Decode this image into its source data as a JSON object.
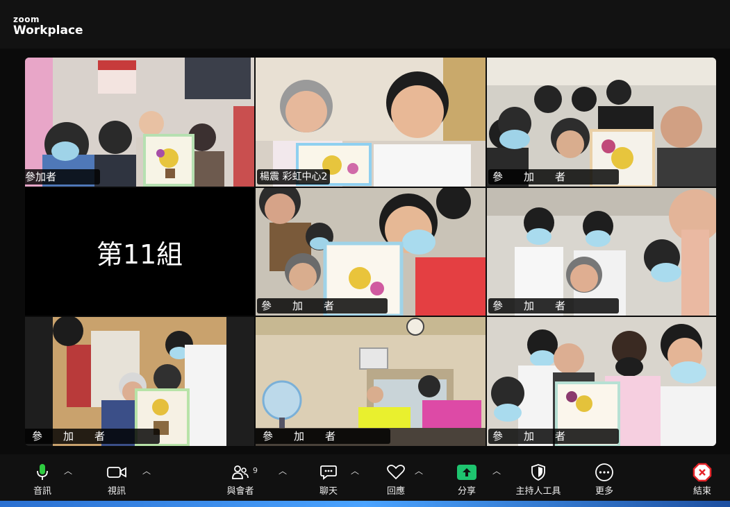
{
  "app": {
    "logo_top": "zoom",
    "logo_bottom": "Workplace"
  },
  "tiles": [
    {
      "name": "參加者"
    },
    {
      "name": "楊震 彩虹中心2",
      "active": true
    },
    {
      "name": "參　　加　　者"
    },
    {
      "label": "第11組"
    },
    {
      "name": "參　　加　　者"
    },
    {
      "name": "參　　加　　者"
    },
    {
      "name": "參　　加　　者"
    },
    {
      "name": "參　　加　　者"
    },
    {
      "name": "參　　加　　者"
    }
  ],
  "toolbar": {
    "audio": "音訊",
    "video": "視訊",
    "participants": "與會者",
    "participants_count": "9",
    "chat": "聊天",
    "reactions": "回應",
    "share": "分享",
    "host_tools": "主持人工具",
    "more": "更多",
    "end": "結束"
  },
  "colors": {
    "active_speaker": "#18c77a",
    "share": "#1ec46f",
    "end": "#e5252a",
    "mic": "#2ecc40"
  }
}
